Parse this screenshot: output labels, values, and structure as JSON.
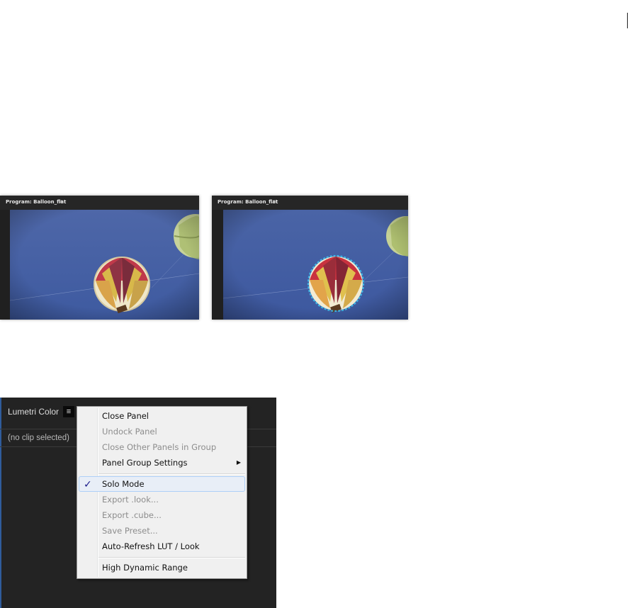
{
  "monitors": [
    {
      "title": "Program: Balloon_flat",
      "menu_icon": "hamburger-icon"
    },
    {
      "title": "Program: Balloon_flat",
      "menu_icon": "hamburger-icon"
    }
  ],
  "panel": {
    "title": "Lumetri Color",
    "menu_glyph": "≡",
    "clip_status": "(no clip selected)"
  },
  "context_menu": {
    "items": [
      {
        "label": "Close Panel",
        "enabled": true
      },
      {
        "label": "Undock Panel",
        "enabled": false
      },
      {
        "label": "Close Other Panels in Group",
        "enabled": false
      },
      {
        "label": "Panel Group Settings",
        "enabled": true,
        "submenu": true
      },
      {
        "label": "Solo Mode",
        "enabled": true,
        "checked": true,
        "highlighted": true
      },
      {
        "label": "Export .look...",
        "enabled": false
      },
      {
        "label": "Export .cube...",
        "enabled": false
      },
      {
        "label": "Save Preset...",
        "enabled": false
      },
      {
        "label": "Auto-Refresh LUT / Look",
        "enabled": true
      },
      {
        "label": "High Dynamic Range",
        "enabled": true
      }
    ],
    "check_glyph": "✓",
    "arrow_glyph": "▶"
  },
  "colors": {
    "sky": "#4a66a6",
    "panel_bg": "#232323",
    "menu_bg": "#f0f0f0",
    "selection_outline": "#3fb7e6"
  }
}
